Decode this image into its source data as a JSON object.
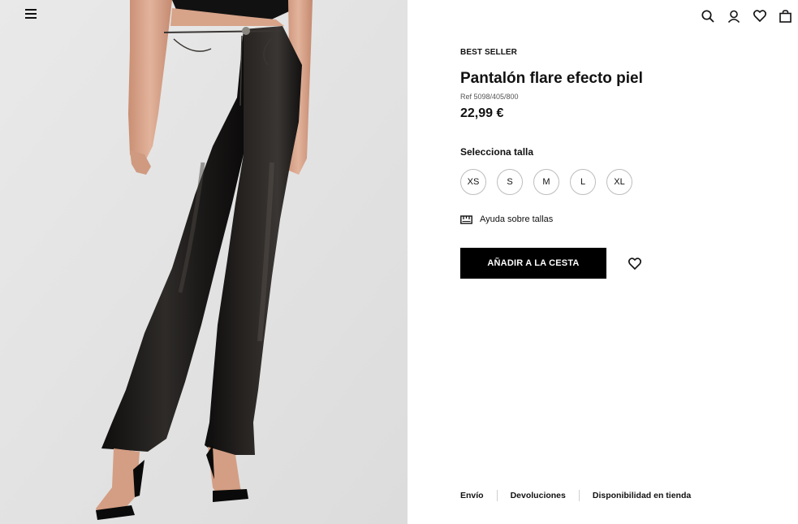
{
  "header": {
    "icons": [
      "menu-icon",
      "search-icon",
      "account-icon",
      "heart-icon",
      "bag-icon"
    ]
  },
  "product": {
    "badge": "BEST SELLER",
    "title": "Pantalón flare efecto piel",
    "ref": "Ref 5098/405/800",
    "price": "22,99 €",
    "size_label": "Selecciona talla",
    "sizes": [
      "XS",
      "S",
      "M",
      "L",
      "XL"
    ],
    "size_help": "Ayuda sobre tallas",
    "add_to_cart": "AÑADIR A LA CESTA"
  },
  "footer": {
    "links": [
      "Envío",
      "Devoluciones",
      "Disponibilidad en tienda"
    ]
  },
  "colors": {
    "image_bg": "#e4e4e4",
    "button_bg": "#000000",
    "leather": "#1c1a19",
    "skin": "#d9a58a"
  }
}
